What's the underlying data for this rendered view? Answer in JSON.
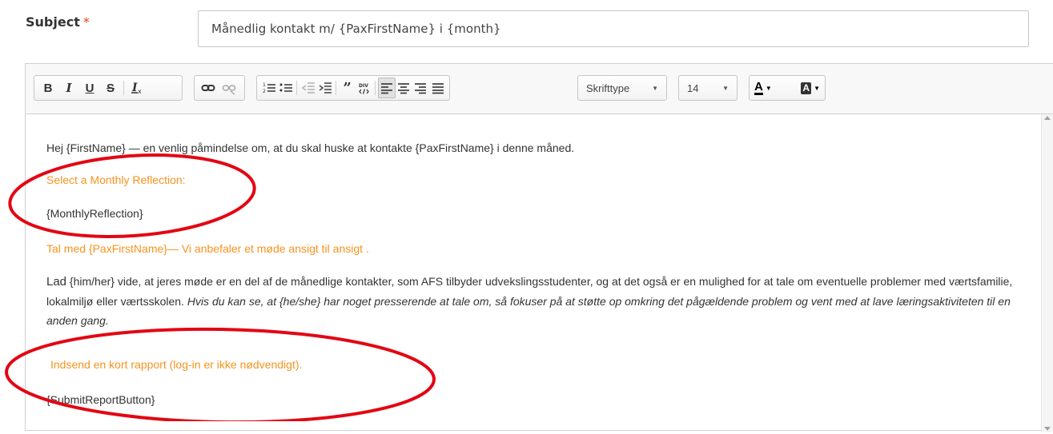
{
  "form": {
    "subject_label": "Subject",
    "required_mark": "*",
    "subject_value": "Månedlig kontakt m/ {PaxFirstName} i {month}"
  },
  "toolbar": {
    "bold": "B",
    "italic": "I",
    "underline": "U",
    "strike": "S",
    "remove_format": "Ix",
    "link": "link",
    "unlink": "unlink",
    "numbered_list": "1≡",
    "bulleted_list": "•≡",
    "outdent": "outdent",
    "indent": "indent",
    "blockquote": "99",
    "div": "DIV",
    "font_label": "Skrifttype",
    "size_label": "14",
    "text_color": "A",
    "bg_color": "A"
  },
  "body": {
    "line1": "Hej {FirstName} — en venlig påmindelse om, at du skal huske at kontakte {PaxFirstName} i denne måned.",
    "heading1": "Select a Monthly Reflection:",
    "placeholder1": "{MonthlyReflection}",
    "heading2": "Tal med {PaxFirstName}— Vi anbefaler et møde ansigt til ansigt .",
    "para_lad": "Lad",
    "para_normal": " {him/her} vide, at jeres møde er en del af de månedlige kontakter, som AFS tilbyder udvekslingsstudenter, og at det også er en mulighed for at tale om eventuelle problemer med værtsfamilie, lokalmiljø eller værtsskolen. ",
    "para_italic": "Hvis du kan se, at {he/she} har noget presserende at tale om, så fokuser på at støtte op omkring det pågældende problem og vent med at lave læringsaktiviteten til en anden gang.",
    "heading3": "Indsend en kort rapport (log-in er ikke nødvendigt).",
    "placeholder2": "{SubmitReportButton}"
  },
  "colors": {
    "accent_orange": "#f7931e",
    "annotation_red": "#e30613"
  }
}
